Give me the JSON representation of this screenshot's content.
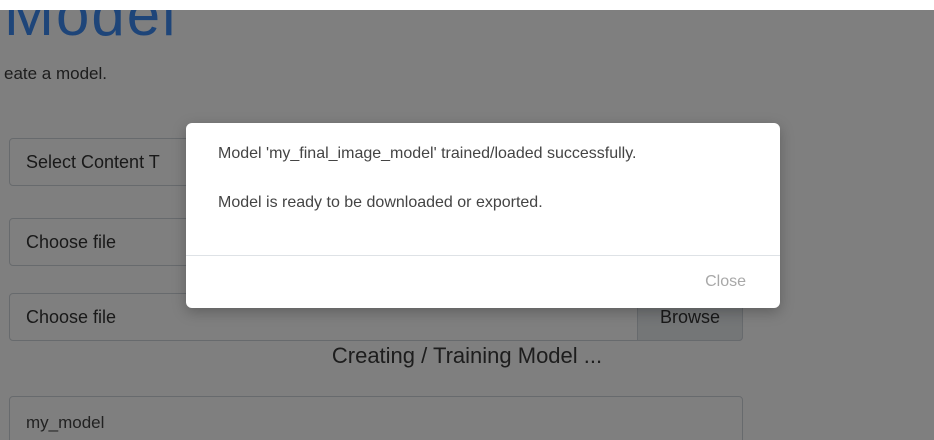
{
  "page": {
    "heading": "Model",
    "subtitle": "eate a model."
  },
  "form": {
    "content_type_select": "Select Content T",
    "file_input_1": "Choose file",
    "file_input_2": "Choose file",
    "browse_label": "Browse",
    "status_text": "Creating / Training Model ...",
    "model_name_value": "my_model"
  },
  "modal": {
    "message_1": "Model 'my_final_image_model' trained/loaded successfully.",
    "message_2": "Model is ready to be downloaded or exported.",
    "close_label": "Close"
  },
  "colors": {
    "heading": "#3d8bf2",
    "overlay": "rgba(0,0,0,0.5)",
    "close_text": "#a8a8a8"
  }
}
